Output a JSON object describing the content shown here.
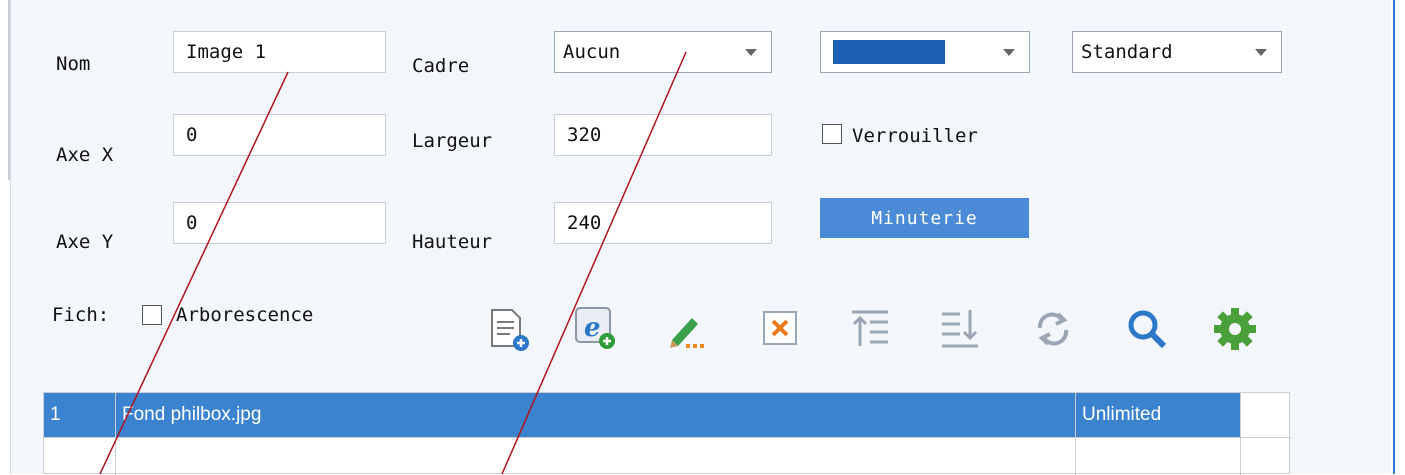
{
  "form": {
    "nom_label": "Nom",
    "nom_value": "Image 1",
    "cadre_label": "Cadre",
    "cadre_value": "Aucun",
    "color_value": "#1f5fb3",
    "style_value": "Standard",
    "axe_x_label": "Axe X",
    "axe_x_value": "0",
    "largeur_label": "Largeur",
    "largeur_value": "320",
    "verrouiller_label": "Verrouiller",
    "axe_y_label": "Axe Y",
    "axe_y_value": "0",
    "hauteur_label": "Hauteur",
    "hauteur_value": "240",
    "minuterie_label": "Minuterie",
    "fich_label": "Fich:",
    "arborescence_label": "Arborescence"
  },
  "toolbar": {
    "icons": [
      "add-file-icon",
      "add-web-icon",
      "edit-icon",
      "delete-icon",
      "move-up-icon",
      "move-down-icon",
      "refresh-icon",
      "search-icon",
      "settings-icon"
    ]
  },
  "list": {
    "rows": [
      {
        "index": "1",
        "name": "Fond philbox.jpg",
        "duration": "Unlimited"
      }
    ]
  },
  "colors": {
    "accent": "#4a8ad6",
    "selection": "#3b83cf",
    "annotation": "#b0141e"
  }
}
